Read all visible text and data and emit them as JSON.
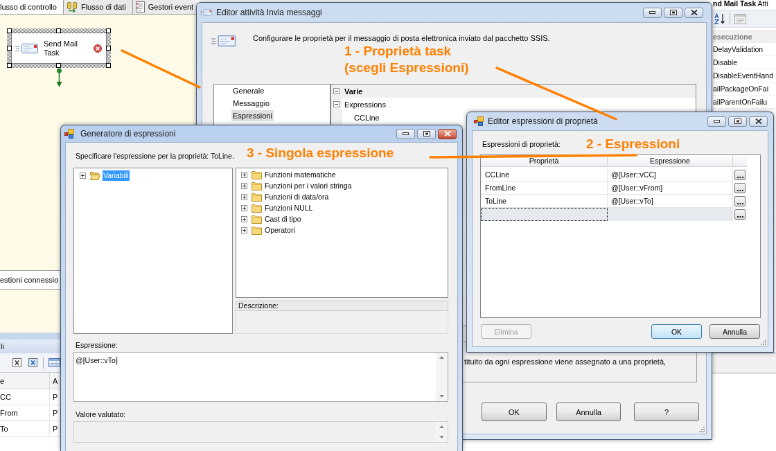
{
  "designer": {
    "tabs": [
      {
        "label": "lusso di controllo",
        "selected": true
      },
      {
        "label": "Flusso di dati",
        "selected": false
      },
      {
        "label": "Gestori event",
        "selected": false
      }
    ],
    "task": {
      "label": "Send Mail Task",
      "selected": true,
      "error": true
    },
    "connections_panel": "estioni connessio",
    "variables_panel": {
      "title": "li",
      "columns": [
        "e",
        "A"
      ],
      "rows": [
        [
          "CC",
          "P"
        ],
        [
          "From",
          "P"
        ],
        [
          "To",
          "P"
        ]
      ]
    }
  },
  "properties_panel": {
    "title": "**nd Mail Task** Atti",
    "category": "esecuzione",
    "items": [
      "DelayValidation",
      "Disable",
      "DisableEventHand",
      "ailPackageOnFai",
      "ailParentOnFailu"
    ]
  },
  "task_editor": {
    "title": "Editor attività Invia messaggi",
    "active": false,
    "description": "Configurare le proprietà per il messaggio di posta elettronica inviato dal pacchetto SSIS.",
    "pages": [
      {
        "label": "Generale",
        "selected": false
      },
      {
        "label": "Messaggio",
        "selected": false
      },
      {
        "label": "Espressioni",
        "selected": true
      }
    ],
    "grid": [
      {
        "kind": "category",
        "label": "Varie",
        "expanded": true
      },
      {
        "kind": "group",
        "label": "Expressions",
        "expanded": true
      },
      {
        "kind": "property",
        "label": "CCLine"
      }
    ],
    "help_text": "tituito da ogni espressione viene assegnato a una proprietà,",
    "buttons": [
      "OK",
      "Annulla",
      "?"
    ]
  },
  "expression_builder": {
    "title": "Generatore di espressioni",
    "active": true,
    "prompt": "Specificare l'espressione per la proprietà: ToLine.",
    "variables_tree": [
      {
        "label": "Variabili",
        "expanded": false,
        "selected": true
      }
    ],
    "functions_tree": [
      {
        "label": "Funzioni matematiche",
        "expanded": false,
        "selected": false
      },
      {
        "label": "Funzioni per i valori stringa",
        "expanded": false,
        "selected": false
      },
      {
        "label": "Funzioni di data/ora",
        "expanded": false,
        "selected": false
      },
      {
        "label": "Funzioni NULL",
        "expanded": false,
        "selected": false
      },
      {
        "label": "Cast di tipo",
        "expanded": false,
        "selected": false
      },
      {
        "label": "Operatori",
        "expanded": false,
        "selected": false
      }
    ],
    "description_label": "Descrizione:",
    "expression_label": "Espressione:",
    "expression": "@[User::vTo]",
    "evaluated_label": "Valore valutato:"
  },
  "property_expressions_editor": {
    "title": "Editor espressioni di proprietà",
    "active": false,
    "label": "Espressioni di proprietà:",
    "columns": [
      "Proprietà",
      "Espressione"
    ],
    "rows": [
      {
        "property": "CCLine",
        "expression": "@[User::vCC]"
      },
      {
        "property": "FromLine",
        "expression": "@[User::vFrom]"
      },
      {
        "property": "ToLine",
        "expression": "@[User::vTo]"
      }
    ],
    "buttons": [
      {
        "label": "Elimina",
        "disabled": true,
        "default": false
      },
      {
        "label": "OK",
        "disabled": false,
        "default": true
      },
      {
        "label": "Annulla",
        "disabled": false,
        "default": false
      }
    ]
  },
  "annotations": [
    {
      "lines": [
        "1 - Proprietà task",
        "(scegli Espressioni)"
      ]
    },
    {
      "lines": [
        "2 - Espressioni"
      ]
    },
    {
      "lines": [
        "3 - Singola espressione"
      ]
    }
  ]
}
